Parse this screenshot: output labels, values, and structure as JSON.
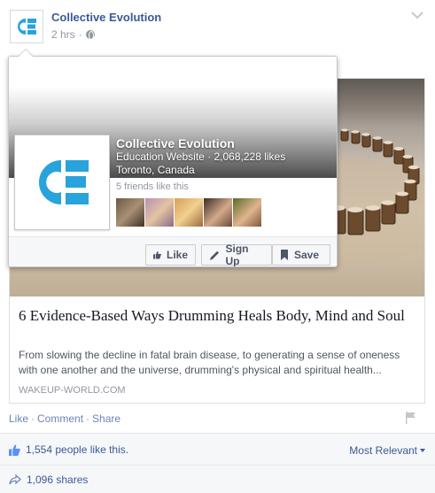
{
  "post": {
    "page_name": "Collective Evolution",
    "time": "2 hrs",
    "separator": "·"
  },
  "logo": {
    "text": "CE",
    "color": "#29a3dc"
  },
  "hovercard": {
    "name": "Collective Evolution",
    "category_likes": "Education Website · 2,068,228 likes",
    "location": "Toronto, Canada",
    "friends_like": "5 friends like this",
    "buttons": {
      "like": "Like",
      "sign_up": "Sign Up",
      "save": "Save"
    }
  },
  "attachment": {
    "title": "6 Evidence-Based Ways Drumming Heals Body, Mind and Soul",
    "description": "From slowing the decline in fatal brain disease, to generating a sense of oneness with one another and the universe, drumming's physical and spiritual health...",
    "domain": "WAKEUP-WORLD.COM"
  },
  "actions": {
    "like": "Like",
    "comment": "Comment",
    "share": "Share",
    "separator": "·"
  },
  "ufi": {
    "likes": "1,554 people like this.",
    "sort": "Most Relevant",
    "shares": "1,096 shares"
  },
  "colors": {
    "brand_blue": "#3b5998",
    "link_blue": "#6d84b4",
    "logo_cyan": "#29a3dc",
    "muted": "#9197a3"
  }
}
